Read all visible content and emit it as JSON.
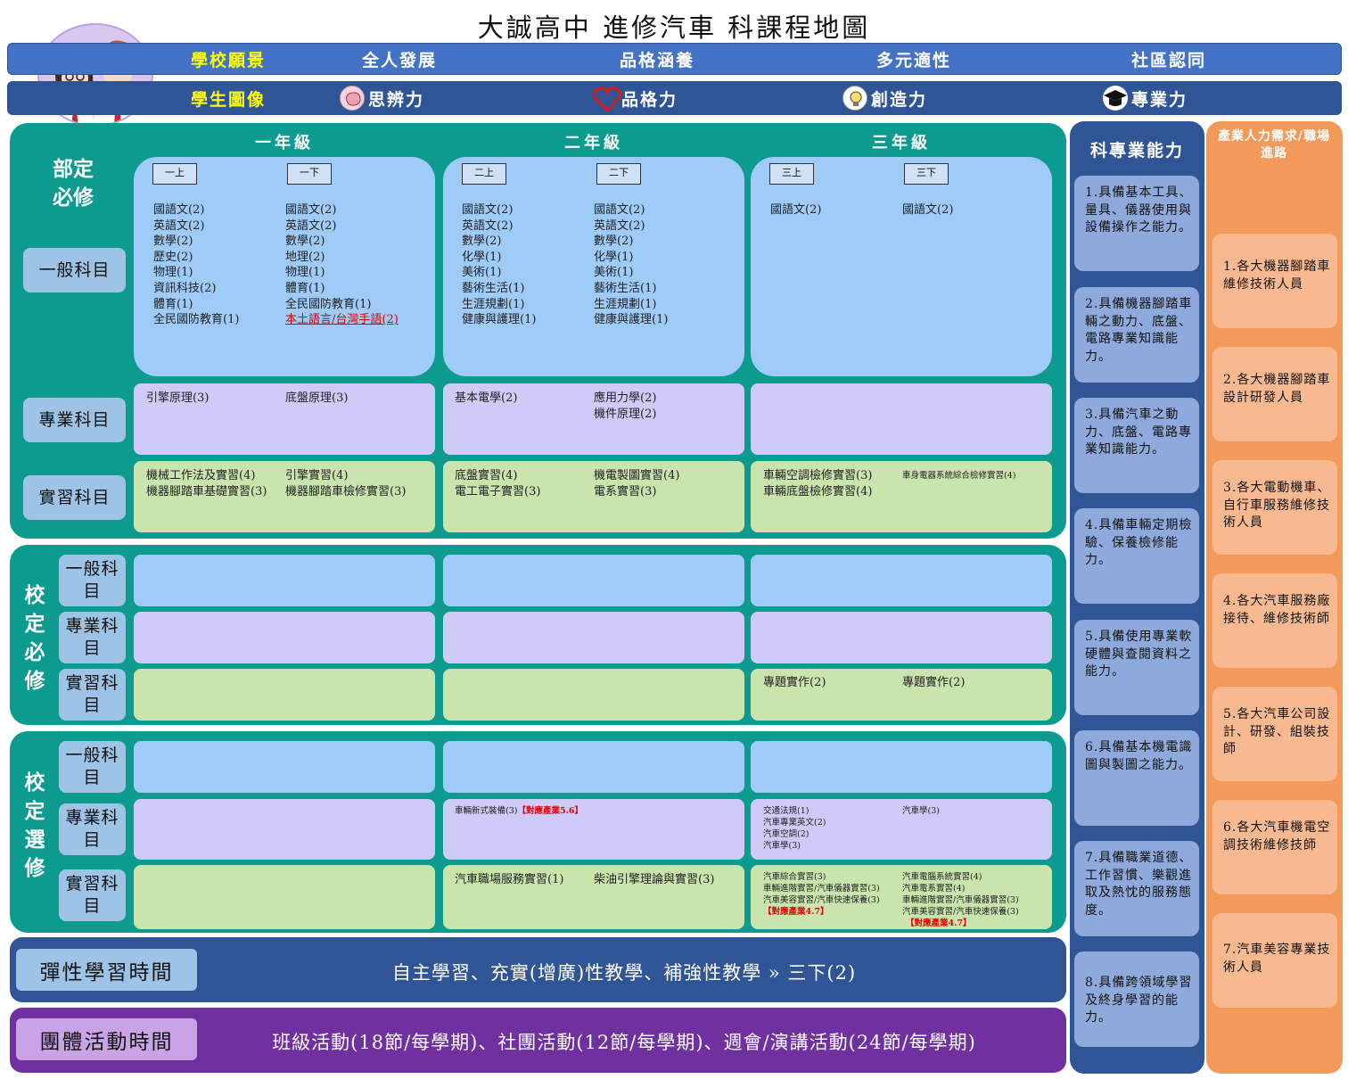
{
  "title": "大誠高中  進修汽車 科課程地圖",
  "vision": {
    "label": "學校願景",
    "items": [
      "全人發展",
      "品格涵養",
      "多元適性",
      "社區認同"
    ]
  },
  "portrait": {
    "label": "學生圖像",
    "items": [
      "思辨力",
      "品格力",
      "創造力",
      "專業力"
    ]
  },
  "grades": [
    "一年級",
    "二年級",
    "三年級"
  ],
  "terms": [
    "一上",
    "一下",
    "二上",
    "二下",
    "三上",
    "三下"
  ],
  "sections": {
    "dept": "部定必修",
    "school_req": "校定必修",
    "school_elec": "校定選修"
  },
  "rows": {
    "general": "一般科目",
    "professional": "專業科目",
    "practice": "實習科目"
  },
  "dept_general": {
    "y1a": [
      "國語文(2)",
      "英語文(2)",
      "數學(2)",
      "歷史(2)",
      "物理(1)",
      "資訊科技(2)",
      "體育(1)",
      "全民國防教育(1)"
    ],
    "y1b": [
      "國語文(2)",
      "英語文(2)",
      "數學(2)",
      "地理(2)",
      "物理(1)",
      "體育(1)",
      "全民國防教育(1)"
    ],
    "y1b_red": "本土語言/台灣手語(2)",
    "y2a": [
      "國語文(2)",
      "英語文(2)",
      "數學(2)",
      "化學(1)",
      "美術(1)",
      "藝術生活(1)",
      "生涯規劃(1)",
      "健康與護理(1)"
    ],
    "y2b": [
      "國語文(2)",
      "英語文(2)",
      "數學(2)",
      "化學(1)",
      "美術(1)",
      "藝術生活(1)",
      "生涯規劃(1)",
      "健康與護理(1)"
    ],
    "y3a": [
      "國語文(2)"
    ],
    "y3b": [
      "國語文(2)"
    ]
  },
  "dept_pro": {
    "y1a": [
      "引擎原理(3)"
    ],
    "y1b": [
      "底盤原理(3)"
    ],
    "y2a": [
      "基本電學(2)"
    ],
    "y2b": [
      "應用力學(2)",
      "機件原理(2)"
    ]
  },
  "dept_prac": {
    "y1a": [
      "機械工作法及實習(4)",
      "機器腳踏車基礎實習(3)"
    ],
    "y1b": [
      "引擎實習(4)",
      "機器腳踏車檢修實習(3)"
    ],
    "y2a": [
      "底盤實習(4)",
      "電工電子實習(3)"
    ],
    "y2b": [
      "機電製圖實習(4)",
      "電系實習(3)"
    ],
    "y3a": [
      "車輛空調檢修實習(3)",
      "車輛底盤檢修實習(4)"
    ],
    "y3b": [
      "車身電器系統綜合檢修實習(4)"
    ]
  },
  "sreq_prac": {
    "y3a": [
      "專題實作(2)"
    ],
    "y3b": [
      "專題實作(2)"
    ]
  },
  "selec_pro": {
    "y2a": "車輛新式裝備(3)",
    "y2a_tag": "【對應產業5.6】",
    "y3a": [
      "交通法規(1)",
      "汽車專業英文(2)",
      "汽車空調(2)",
      "汽車學(3)"
    ],
    "y3b": [
      "汽車學(3)"
    ]
  },
  "selec_prac": {
    "y2a": [
      "汽車職場服務實習(1)"
    ],
    "y2b": [
      "柴油引擎理論與實習(3)"
    ],
    "y3a": [
      "汽車綜合實習(3)",
      "車輛進階實習/汽車儀器實習(3)",
      "汽車美容實習/汽車快速保養(3)"
    ],
    "y3a_tag": "【對應產業4.7】",
    "y3b": [
      "汽車電腦系統實習(4)",
      "汽車電系實習(4)",
      "車輛進階實習/汽車儀器實習(3)",
      "汽車美容實習/汽車快速保養(3)"
    ],
    "y3b_tag": "【對應產業4.7】"
  },
  "flex": {
    "label": "彈性學習時間",
    "text": "自主學習、充實(增廣)性教學、補強性教學 » 三下(2)"
  },
  "group": {
    "label": "團體活動時間",
    "text": "班級活動(18節/每學期)、社團活動(12節/每學期)、週會/演講活動(24節/每學期)"
  },
  "capabilities": {
    "title": "科專業能力",
    "items": [
      "1.具備基本工具、量具、儀器使用與設備操作之能力。",
      "2.具備機器腳踏車輛之動力、底盤、電路專業知識能力。",
      "3.具備汽車之動力、底盤、電路專業知識能力。",
      "4.具備車輛定期檢驗、保養檢修能力。",
      "5.具備使用專業軟硬體與查閱資料之能力。",
      "6.具備基本機電識圖與製圖之能力。",
      "7.具備職業道德、工作習慣、樂觀進取及熱忱的服務態度。",
      "8.具備跨領域學習及終身學習的能力。"
    ]
  },
  "industry": {
    "title": "產業人力需求/職場進路",
    "items": [
      "1.各大機器腳踏車維修技術人員",
      "2.各大機器腳踏車設計研發人員",
      "3.各大電動機車、自行車服務維修技術人員",
      "4.各大汽車服務廠接待、維修技術師",
      "5.各大汽車公司設計、研發、組裝技師",
      "6.各大汽車機電空調技術維修技師",
      "7.汽車美容專業技術人員"
    ]
  },
  "colors": {
    "vision_bar": "#4472c4",
    "panel": "#0d9a8f",
    "capabilities": "#2f5597",
    "industry": "#f39a5a",
    "group": "#7030a0"
  },
  "icons": [
    "brain-icon",
    "heart-icon",
    "lightbulb-icon",
    "graduation-cap-icon"
  ]
}
